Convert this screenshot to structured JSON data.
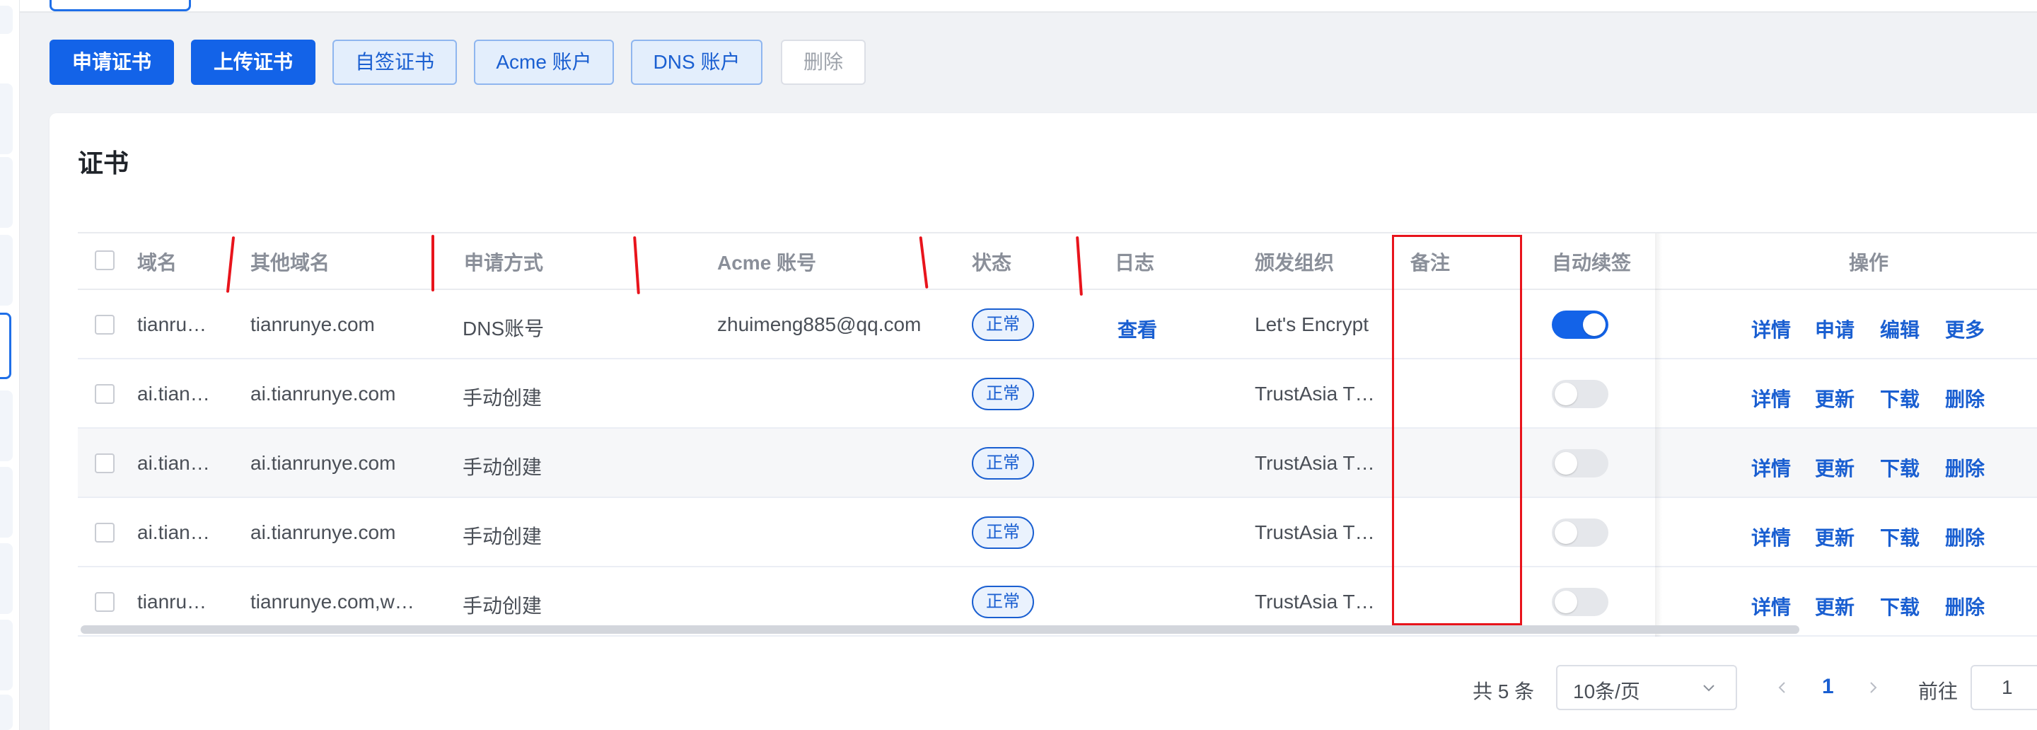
{
  "toolbar": {
    "apply_cert": "申请证书",
    "upload_cert": "上传证书",
    "self_signed": "自签证书",
    "acme_account": "Acme 账户",
    "dns_account": "DNS 账户",
    "delete": "删除"
  },
  "card": {
    "title": "证书"
  },
  "table": {
    "columns": {
      "domain": "域名",
      "other_domains": "其他域名",
      "method": "申请方式",
      "acme_account": "Acme 账号",
      "status": "状态",
      "log": "日志",
      "issuer": "颁发组织",
      "remark": "备注",
      "auto_renew": "自动续签",
      "actions": "操作"
    },
    "rows": [
      {
        "domain": "tianru…",
        "other_domains": "tianrunye.com",
        "method": "DNS账号",
        "acme_account": "zhuimeng885@qq.com",
        "status": "正常",
        "log": "查看",
        "issuer": "Let's Encrypt",
        "remark": "",
        "auto_renew": true,
        "actions": [
          "详情",
          "申请",
          "编辑",
          "更多"
        ]
      },
      {
        "domain": "ai.tian…",
        "other_domains": "ai.tianrunye.com",
        "method": "手动创建",
        "acme_account": "",
        "status": "正常",
        "log": "",
        "issuer": "TrustAsia T…",
        "remark": "",
        "auto_renew": false,
        "actions": [
          "详情",
          "更新",
          "下载",
          "删除"
        ]
      },
      {
        "domain": "ai.tian…",
        "other_domains": "ai.tianrunye.com",
        "method": "手动创建",
        "acme_account": "",
        "status": "正常",
        "log": "",
        "issuer": "TrustAsia T…",
        "remark": "",
        "auto_renew": false,
        "actions": [
          "详情",
          "更新",
          "下载",
          "删除"
        ]
      },
      {
        "domain": "ai.tian…",
        "other_domains": "ai.tianrunye.com",
        "method": "手动创建",
        "acme_account": "",
        "status": "正常",
        "log": "",
        "issuer": "TrustAsia T…",
        "remark": "",
        "auto_renew": false,
        "actions": [
          "详情",
          "更新",
          "下载",
          "删除"
        ]
      },
      {
        "domain": "tianru…",
        "other_domains": "tianrunye.com,w…",
        "method": "手动创建",
        "acme_account": "",
        "status": "正常",
        "log": "",
        "issuer": "TrustAsia T…",
        "remark": "",
        "auto_renew": false,
        "actions": [
          "详情",
          "更新",
          "下载",
          "删除"
        ]
      }
    ]
  },
  "pagination": {
    "total": "共 5 条",
    "page_size": "10条/页",
    "current_page": "1",
    "goto_label": "前往",
    "goto_value": "1"
  },
  "icons": {
    "chevron_down": "chevron-down-icon",
    "prev": "chevron-left-icon",
    "next": "chevron-right-icon"
  },
  "colors": {
    "primary": "#1363e8",
    "link": "#1a5fd1",
    "annotation_red": "#e8141c"
  }
}
